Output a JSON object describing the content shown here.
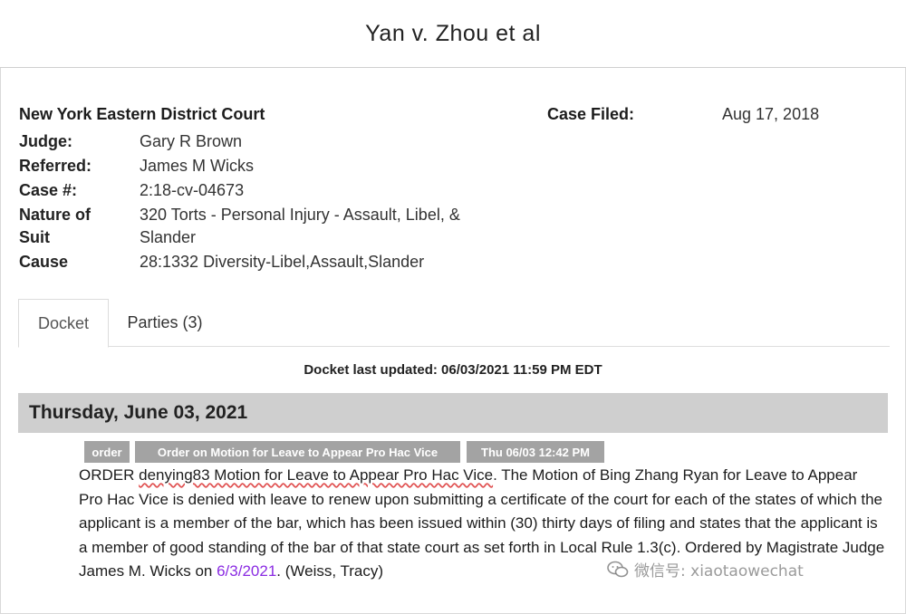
{
  "title": "Yan v. Zhou et al",
  "case": {
    "court": "New York Eastern District Court",
    "filed_label": "Case Filed:",
    "filed_value": "Aug 17, 2018",
    "fields": [
      {
        "label": "Judge:",
        "value": "Gary R Brown"
      },
      {
        "label": "Referred:",
        "value": "James M Wicks"
      },
      {
        "label": "Case #:",
        "value": "2:18-cv-04673"
      },
      {
        "label_line1": "Nature of",
        "label_line2": "Suit",
        "value_line1": "320 Torts - Personal Injury - Assault, Libel, &",
        "value_line2": "Slander"
      },
      {
        "label": "Cause",
        "value": "28:1332 Diversity-Libel,Assault,Slander"
      }
    ]
  },
  "tabs": [
    {
      "label": "Docket",
      "active": true
    },
    {
      "label": "Parties (3)",
      "active": false
    }
  ],
  "docket_updated": "Docket last updated: 06/03/2021 11:59 PM EDT",
  "day_header": "Thursday, June 03, 2021",
  "entry": {
    "badges": [
      "order",
      "Order on Motion for Leave to Appear Pro Hac Vice",
      "Thu 06/03 12:42 PM"
    ],
    "text_prefix": "ORDER ",
    "text_underlined": "denying83 Motion for Leave to Appear Pro Hac Vice",
    "text_main": ". The Motion of Bing Zhang Ryan for Leave to Appear Pro Hac Vice is denied with leave to renew upon submitting a certificate of the court for each of the states of which the applicant is a member of the bar, which has been issued within (30) thirty days of filing and states that the applicant is a member of good standing of the bar of that state court as set forth in Local Rule 1.3(c). Ordered by Magistrate Judge James M. Wicks on ",
    "date_link": "6/3/2021",
    "text_end": ". (Weiss, Tracy)"
  },
  "watermark": "微信号: xiaotaowechat",
  "colors": {
    "day_bar": "#cfcfcf",
    "badge": "#a3a3a3",
    "link": "#8a2be2",
    "underline": "#e05050"
  }
}
